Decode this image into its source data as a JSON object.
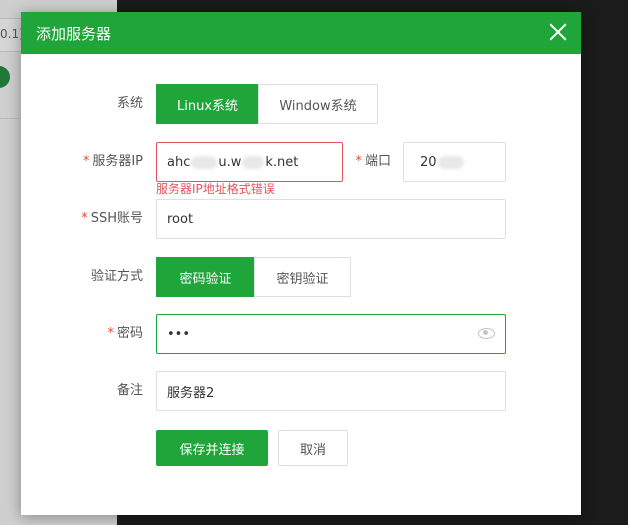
{
  "background": {
    "fragment_text": "0.1]"
  },
  "dialog": {
    "title": "添加服务器",
    "system": {
      "label": "系统",
      "options": [
        "Linux系统",
        "Window系统"
      ],
      "selected": "Linux系统"
    },
    "server_ip": {
      "label": "服务器IP",
      "value_start": "ahc",
      "value_mid": "u.w",
      "value_end": "k.net",
      "error": "服务器IP地址格式错误"
    },
    "port": {
      "label": "端口",
      "value_start": "20"
    },
    "ssh_account": {
      "label": "SSH账号",
      "value": "root"
    },
    "auth_method": {
      "label": "验证方式",
      "options": [
        "密码验证",
        "密钥验证"
      ],
      "selected": "密码验证"
    },
    "password": {
      "label": "密码",
      "value": "•••"
    },
    "note": {
      "label": "备注",
      "value": "服务器2"
    },
    "buttons": {
      "save": "保存并连接",
      "cancel": "取消"
    }
  },
  "colors": {
    "accent": "#20a53a",
    "error": "#e2545d",
    "required": "#e74c3c"
  },
  "icons": {
    "close": "close-icon",
    "eye": "eye-icon"
  }
}
